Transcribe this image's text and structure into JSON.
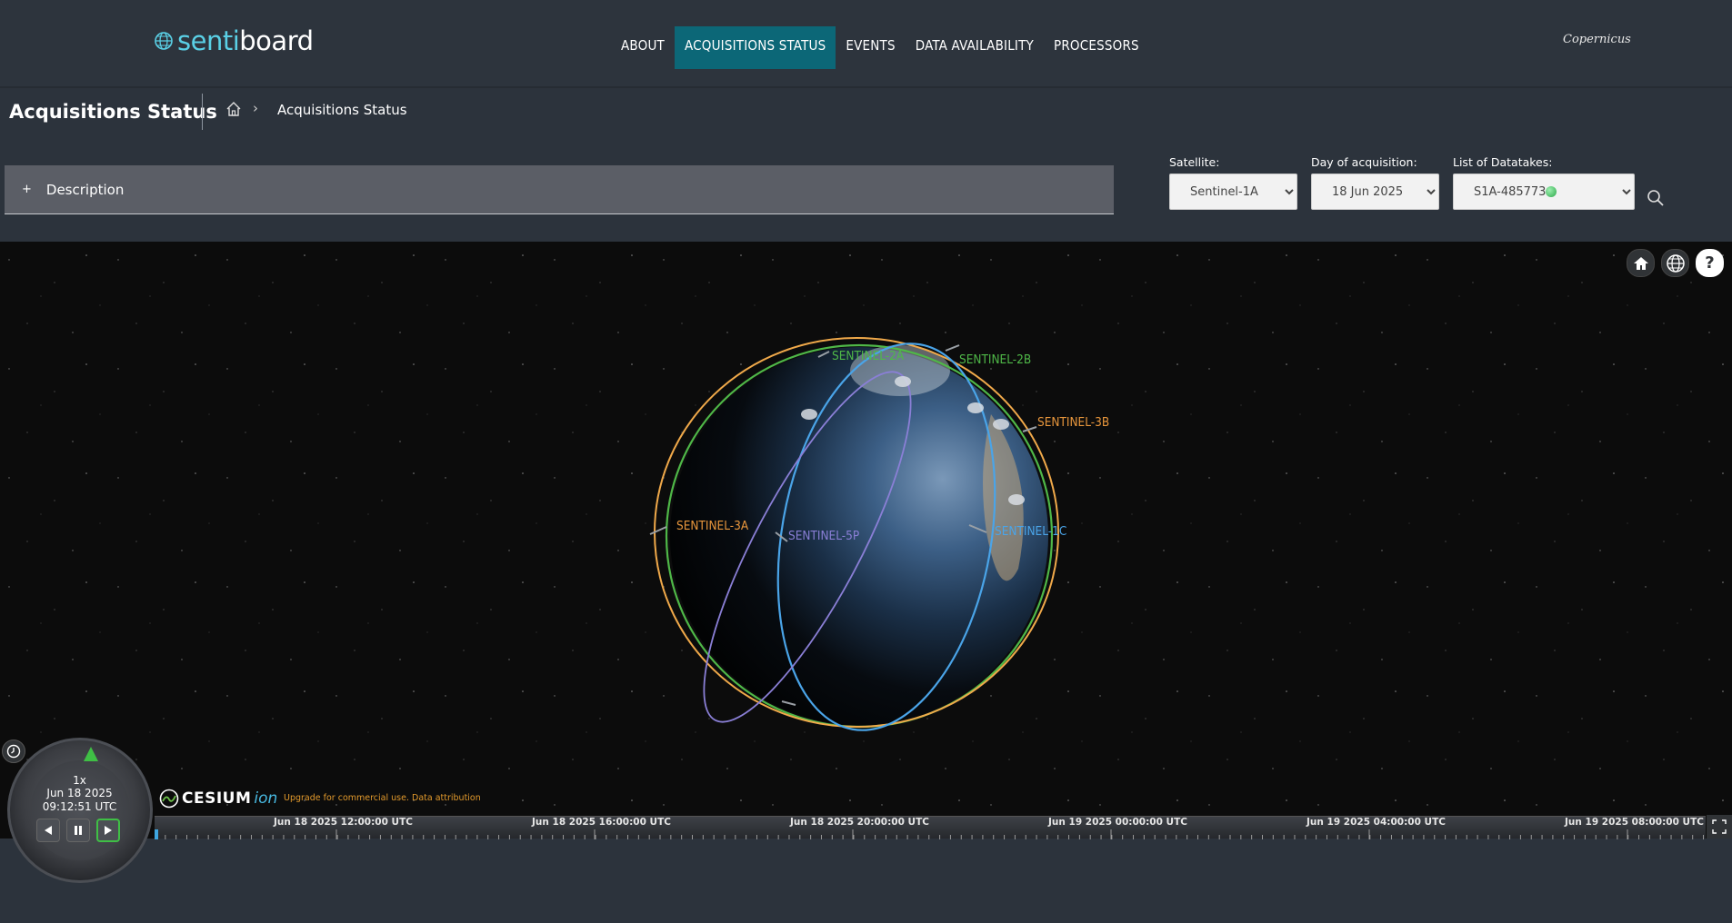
{
  "header": {
    "logo_part1": "senti",
    "logo_part2": "board",
    "nav": [
      {
        "label": "ABOUT",
        "active": false
      },
      {
        "label": "ACQUISITIONS STATUS",
        "active": true
      },
      {
        "label": "EVENTS",
        "active": false
      },
      {
        "label": "DATA AVAILABILITY",
        "active": false
      },
      {
        "label": "PROCESSORS",
        "active": false
      }
    ],
    "partner_logo": "Copernicus"
  },
  "page": {
    "title": "Acquisitions Status",
    "breadcrumb": "Acquisitions Status"
  },
  "description": {
    "toggle": "+",
    "label": "Description"
  },
  "filters": {
    "satellite_label": "Satellite:",
    "satellite_value": "Sentinel-1A",
    "day_label": "Day of acquisition:",
    "day_value": "18 Jun 2025",
    "datatakes_label": "List of Datatakes:",
    "datatakes_value": "S1A-485773"
  },
  "viewer": {
    "satellites": [
      {
        "name": "SENTINEL-2A",
        "color": "#4fb848"
      },
      {
        "name": "SENTINEL-2B",
        "color": "#4fb848"
      },
      {
        "name": "SENTINEL-3B",
        "color": "#e8963c"
      },
      {
        "name": "SENTINEL-3A",
        "color": "#e8963c"
      },
      {
        "name": "SENTINEL-5P",
        "color": "#8a7fd6"
      },
      {
        "name": "SENTINEL-1C",
        "color": "#4aa4e8"
      }
    ]
  },
  "clock": {
    "speed": "1x",
    "date": "Jun 18 2025",
    "time": "09:12:51 UTC"
  },
  "cesium": {
    "name": "CESIUM",
    "ion": "ion",
    "attribution": "Upgrade for commercial use.  Data attribution"
  },
  "timeline": {
    "labels": [
      "Jun 18 2025 12:00:00 UTC",
      "Jun 18 2025 16:00:00 UTC",
      "Jun 18 2025 20:00:00 UTC",
      "Jun 19 2025 00:00:00 UTC",
      "Jun 19 2025 04:00:00 UTC",
      "Jun 19 2025 08:00:00 UTC"
    ]
  },
  "colors": {
    "accent": "#0c6777",
    "header_bg": "#2d343d",
    "orbit_green": "#4fb848",
    "orbit_orange": "#f0a94a",
    "orbit_blue": "#4aa4e8",
    "orbit_purple": "#8a7fd6"
  }
}
